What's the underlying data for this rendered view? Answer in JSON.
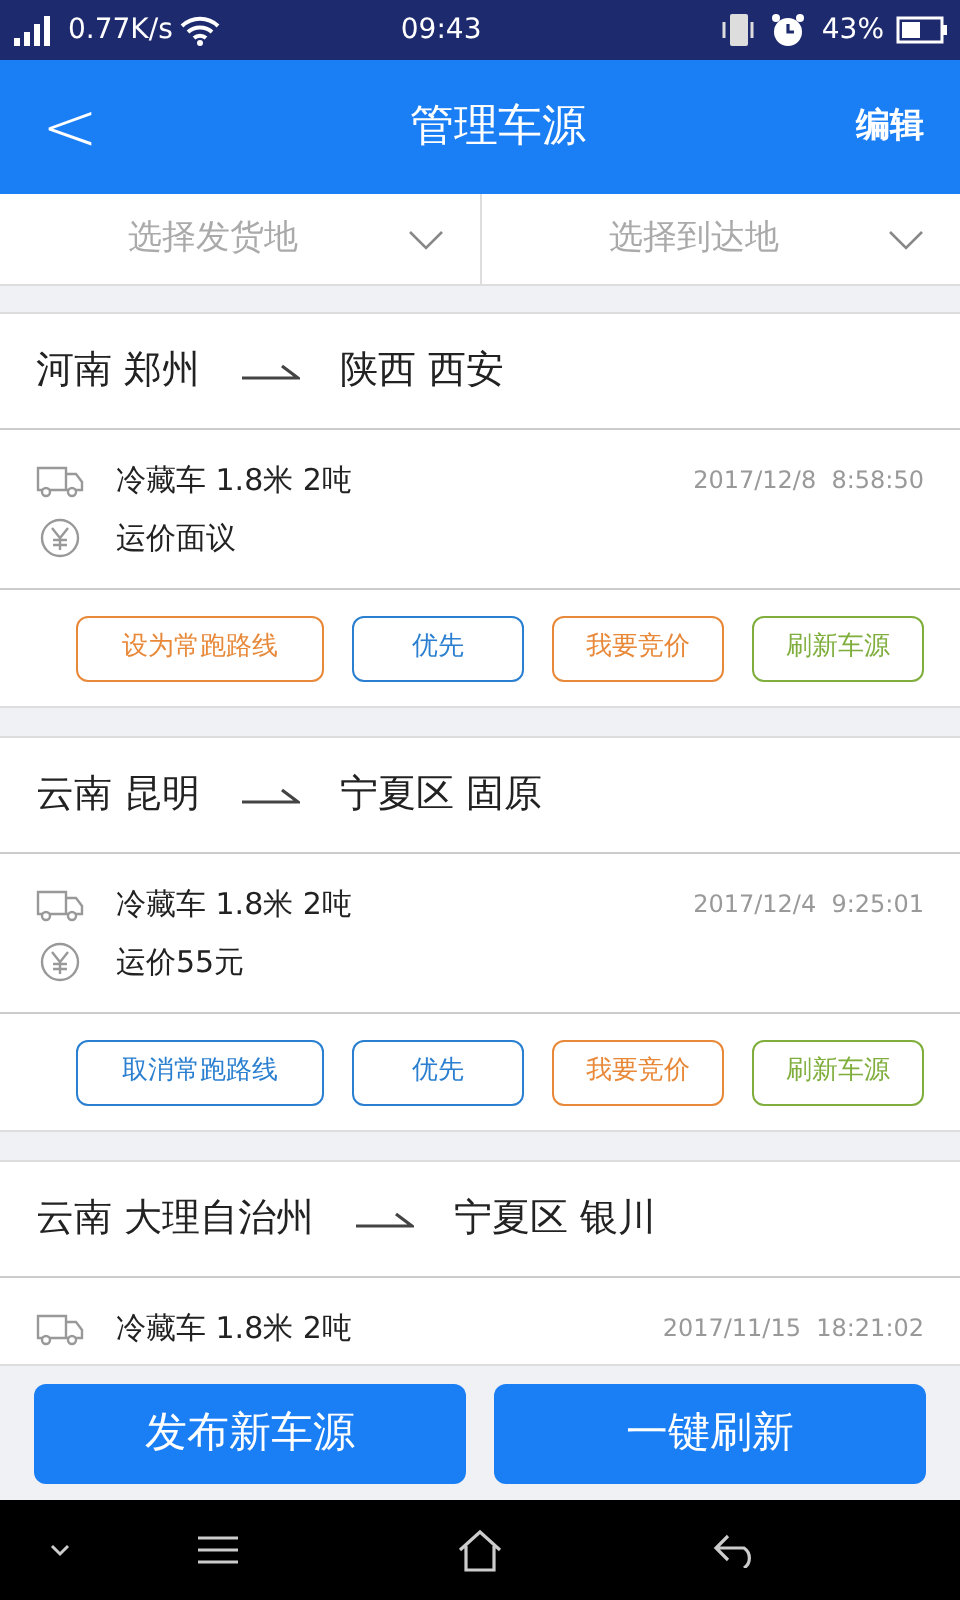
{
  "status_bar": {
    "speed": "0.77K/s",
    "time": "09:43",
    "battery": "43%"
  },
  "header": {
    "back": "<",
    "title": "管理车源",
    "action": "编辑"
  },
  "filters": [
    {
      "placeholder": "选择发货地"
    },
    {
      "placeholder": "选择到达地"
    }
  ],
  "listings": [
    {
      "from": "河南 郑州",
      "to": "陕西 西安",
      "vehicle": "冷藏车 1.8米 2吨",
      "time": "2017/12/8  8:58:50",
      "price": "运价面议",
      "buttons": [
        {
          "label": "设为常跑路线",
          "color": "#e8893a"
        },
        {
          "label": "优先",
          "color": "#2a7fd0"
        },
        {
          "label": "我要竞价",
          "color": "#e8893a"
        },
        {
          "label": "刷新车源",
          "color": "#7fae3c"
        }
      ]
    },
    {
      "from": "云南 昆明",
      "to": "宁夏区 固原",
      "vehicle": "冷藏车 1.8米 2吨",
      "time": "2017/12/4  9:25:01",
      "price": "运价55元",
      "buttons": [
        {
          "label": "取消常跑路线",
          "color": "#2a7fd0"
        },
        {
          "label": "优先",
          "color": "#2a7fd0"
        },
        {
          "label": "我要竞价",
          "color": "#e8893a"
        },
        {
          "label": "刷新车源",
          "color": "#7fae3c"
        }
      ]
    },
    {
      "from": "云南 大理自治州",
      "to": "宁夏区 银川",
      "vehicle": "冷藏车 1.8米 2吨",
      "time": "2017/11/15  18:21:02"
    }
  ],
  "bottom_buttons": [
    "发布新车源",
    "一键刷新"
  ]
}
